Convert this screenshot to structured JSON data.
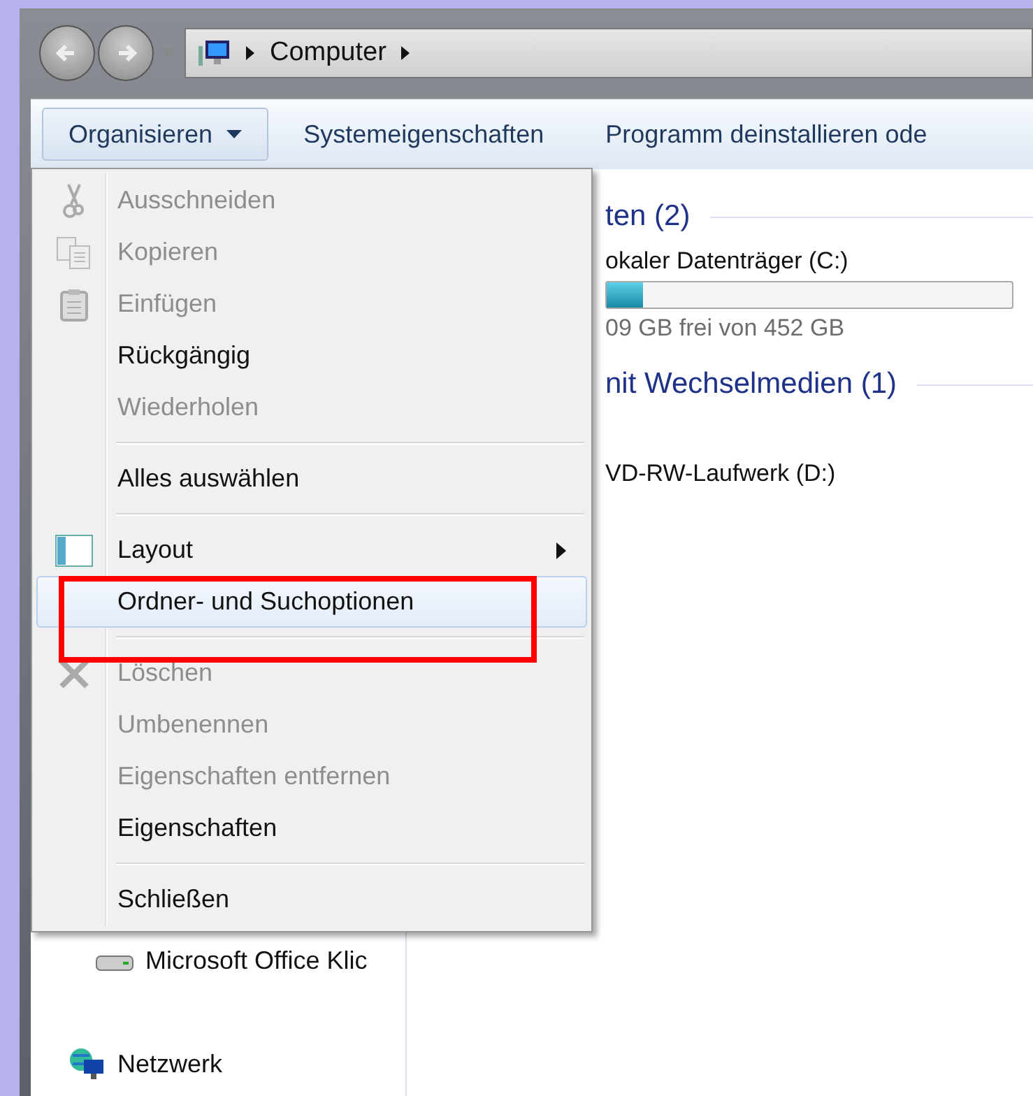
{
  "address_bar": {
    "crumbs": [
      "Computer"
    ]
  },
  "toolbar": {
    "buttons": [
      {
        "label": "Organisieren",
        "selected": true,
        "dropdown": true
      },
      {
        "label": "Systemeigenschaften",
        "selected": false,
        "dropdown": false
      },
      {
        "label": "Programm deinstallieren ode",
        "selected": false,
        "dropdown": false
      }
    ]
  },
  "menu": {
    "items": [
      {
        "kind": "cut",
        "label": "Ausschneiden",
        "disabled": true,
        "selected": false
      },
      {
        "kind": "copy",
        "label": "Kopieren",
        "disabled": true,
        "selected": false
      },
      {
        "kind": "paste",
        "label": "Einfügen",
        "disabled": true,
        "selected": false
      },
      {
        "kind": "item",
        "label": "Rückgängig",
        "disabled": false,
        "selected": false
      },
      {
        "kind": "item",
        "label": "Wiederholen",
        "disabled": true,
        "selected": false
      },
      {
        "kind": "separator"
      },
      {
        "kind": "item",
        "label": "Alles auswählen",
        "disabled": false,
        "selected": false
      },
      {
        "kind": "separator"
      },
      {
        "kind": "layout",
        "label": "Layout",
        "disabled": false,
        "selected": false,
        "submenu": true
      },
      {
        "kind": "item",
        "label": "Ordner- und Suchoptionen",
        "disabled": false,
        "selected": true
      },
      {
        "kind": "separator"
      },
      {
        "kind": "delete",
        "label": "Löschen",
        "disabled": true,
        "selected": false
      },
      {
        "kind": "item",
        "label": "Umbenennen",
        "disabled": true,
        "selected": false
      },
      {
        "kind": "item",
        "label": "Eigenschaften entfernen",
        "disabled": true,
        "selected": false
      },
      {
        "kind": "item",
        "label": "Eigenschaften",
        "disabled": false,
        "selected": false
      },
      {
        "kind": "separator"
      },
      {
        "kind": "item",
        "label": "Schließen",
        "disabled": false,
        "selected": false
      }
    ]
  },
  "nav_pane": {
    "items": [
      {
        "kind": "drive",
        "label": "Microsoft Office Klic"
      },
      {
        "kind": "network",
        "label": "Netzwerk"
      }
    ]
  },
  "content": {
    "groups": [
      {
        "title": "ten (2)",
        "items": [
          {
            "kind": "disk",
            "name": "okaler Datenträger (C:)",
            "level": 0.09,
            "reading": "09 GB frei von 452 GB"
          }
        ]
      },
      {
        "title": "nit Wechselmedien (1)",
        "items": [
          {
            "kind": "dvd",
            "name": "VD-RW-Laufwerk (D:)"
          }
        ]
      }
    ]
  }
}
